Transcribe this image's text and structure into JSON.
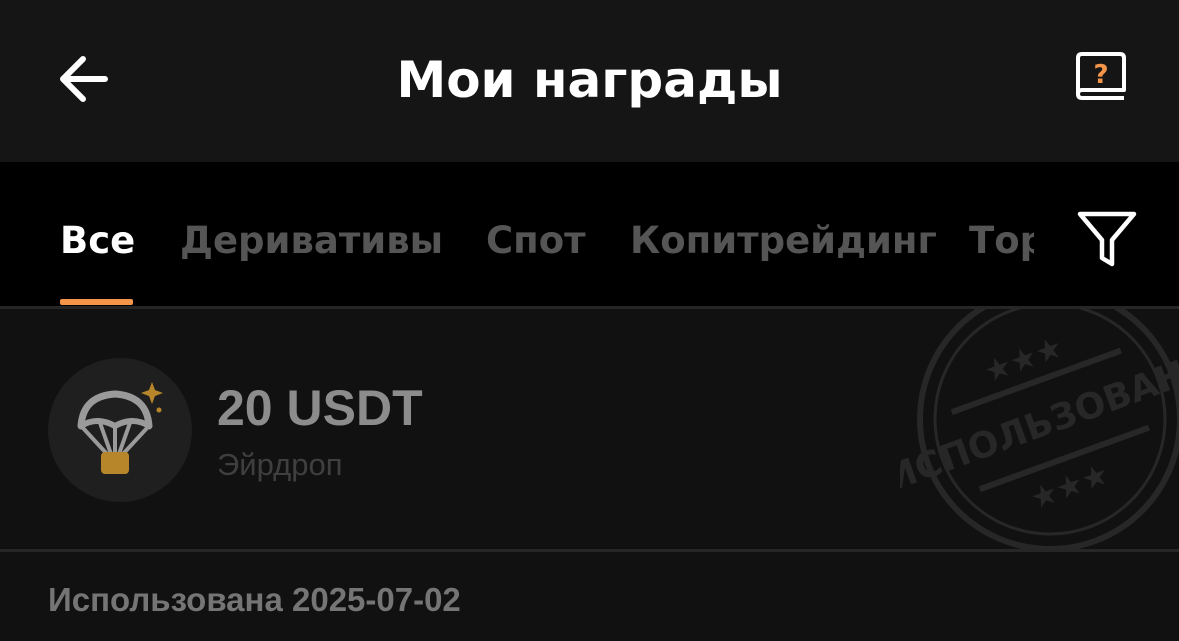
{
  "header": {
    "title": "Мои награды",
    "back_icon": "arrow-left-icon",
    "help_icon": "help-book-icon",
    "help_symbol": "?"
  },
  "tabs": [
    {
      "label": "Все",
      "active": true
    },
    {
      "label": "Деривативы",
      "active": false
    },
    {
      "label": "Спот",
      "active": false
    },
    {
      "label": "Копитрейдинг",
      "active": false
    },
    {
      "label": "Торговля",
      "active": false
    }
  ],
  "filter": {
    "icon": "filter-funnel-icon"
  },
  "reward": {
    "amount": "20 USDT",
    "type": "Эйрдроп",
    "icon": "parachute-airdrop-icon",
    "stamp_text": "ИСПОЛЬЗОВАНО",
    "used_date": "Использована 2025-07-02"
  },
  "colors": {
    "accent": "#f5954a",
    "icon_gold": "#b8862a",
    "header_bg": "#151515",
    "card_bg": "#111111"
  }
}
